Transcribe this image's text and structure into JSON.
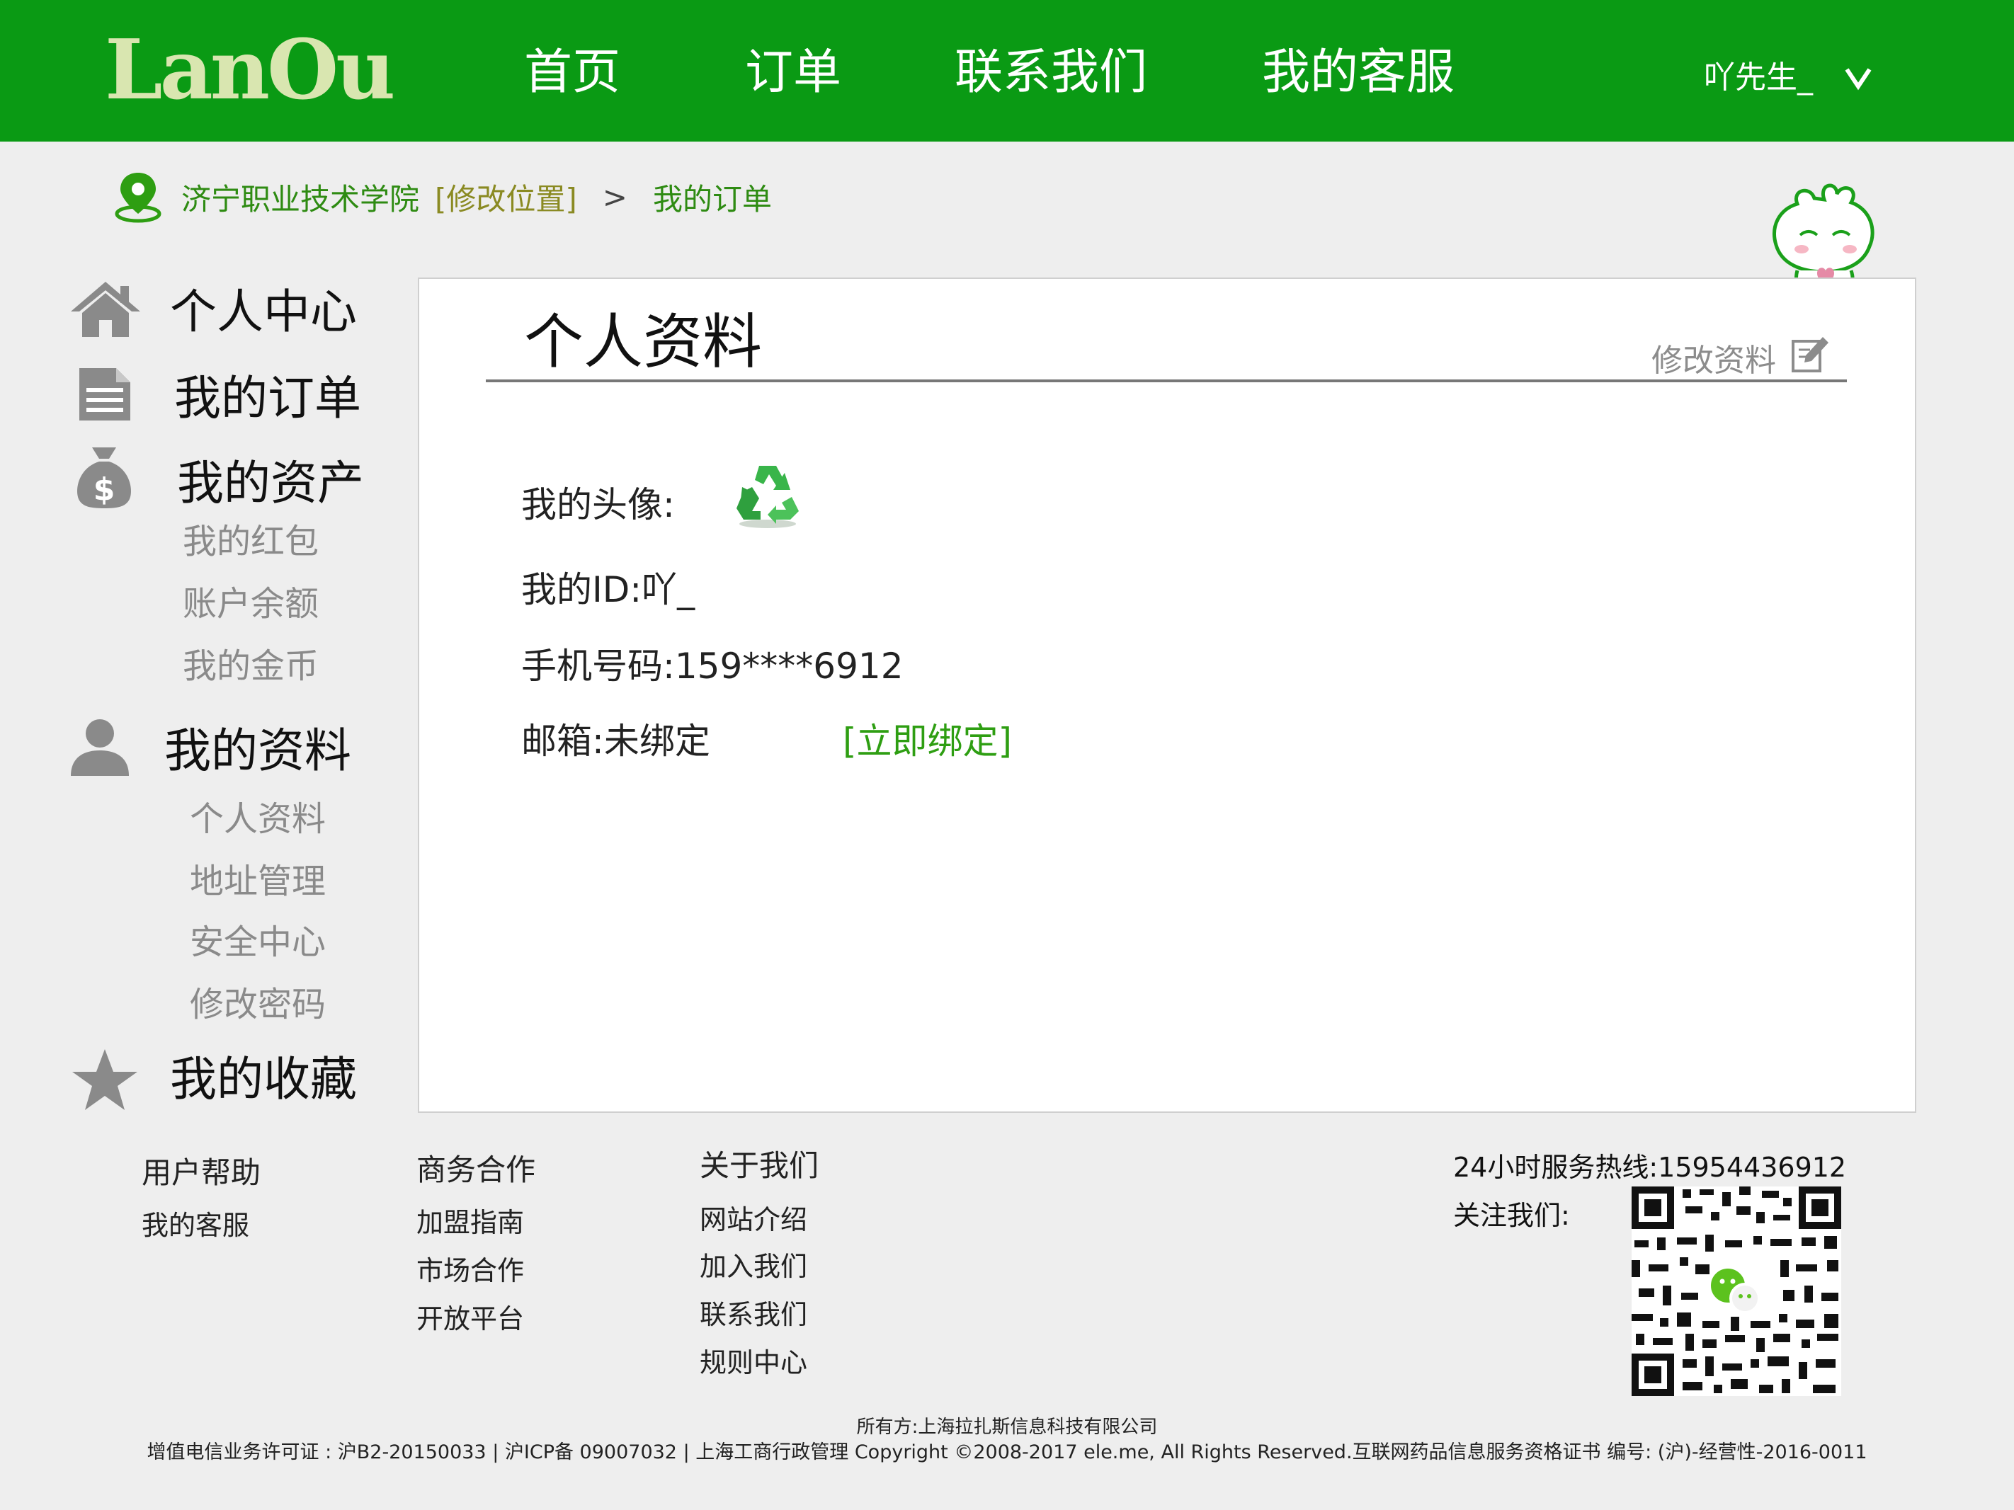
{
  "header": {
    "logo_text": "LanOu",
    "nav": [
      "首页",
      "订单",
      "联系我们",
      "我的客服"
    ],
    "user_name": "吖先生_"
  },
  "breadcrumb": {
    "location": "济宁职业技术学院",
    "edit_location": "[修改位置]",
    "separator": ">",
    "current": "我的订单"
  },
  "sidebar": {
    "personal_center": "个人中心",
    "my_orders": "我的订单",
    "my_assets": "我的资产",
    "assets_items": [
      "我的红包",
      "账户余额",
      "我的金币"
    ],
    "my_profile": "我的资料",
    "profile_items": [
      "个人资料",
      "地址管理",
      "安全中心",
      "修改密码"
    ],
    "my_favorites": "我的收藏"
  },
  "profile": {
    "title": "个人资料",
    "edit_label": "修改资料",
    "avatar_label": "我的头像:",
    "id_label": "我的ID:",
    "id_value": "吖_",
    "phone_label": "手机号码:",
    "phone_value": "159****6912",
    "email_label": "邮箱:",
    "email_value": "未绑定",
    "bind_now": "[立即绑定]"
  },
  "footer": {
    "help_title": "用户帮助",
    "help_links": [
      "我的客服"
    ],
    "business_title": "商务合作",
    "business_links": [
      "加盟指南",
      "市场合作",
      "开放平台"
    ],
    "about_title": "关于我们",
    "about_links": [
      "网站介绍",
      "加入我们",
      "联系我们",
      "规则中心"
    ],
    "hotline": "24小时服务热线:15954436912",
    "follow_us": "关注我们:",
    "owner": "所有方:上海拉扎斯信息科技有限公司",
    "legal": "增值电信业务许可证 : 沪B2-20150033 | 沪ICP备 09007032 | 上海工商行政管理 Copyright ©2008-2017 ele.me, All Rights Reserved.互联网药品信息服务资格证书 编号: (沪)-经营性-2016-0011"
  },
  "colors": {
    "header_green": "#0a9a14",
    "link_green": "#2e8b12",
    "background": "#eeeeee"
  },
  "icons": [
    "location-pin-icon",
    "chevron-down-icon",
    "house-icon",
    "document-icon",
    "money-bag-icon",
    "person-icon",
    "star-icon",
    "edit-icon",
    "recycle-avatar-icon",
    "mascot-icon",
    "qr-code-icon"
  ]
}
